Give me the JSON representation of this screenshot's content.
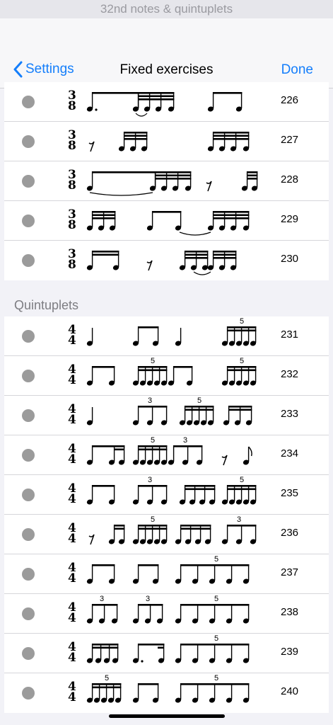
{
  "window": {
    "title": "32nd notes & quintuplets"
  },
  "nav": {
    "back_label": "Settings",
    "title": "Fixed exercises",
    "done_label": "Done"
  },
  "section": {
    "header": "Quintuplets"
  },
  "colors": {
    "accent": "#147efb",
    "dot": "#9b9b9b"
  },
  "exercises_top": [
    {
      "number": "226",
      "time_sig": [
        "3",
        "8"
      ],
      "tuplets": [],
      "pattern": "D . | 32 32 32 32 | 8 8"
    },
    {
      "number": "227",
      "time_sig": [
        "3",
        "8"
      ],
      "tuplets": [],
      "pattern": "rest | 32 32 8 | 32 32 32 32"
    },
    {
      "number": "228",
      "time_sig": [
        "3",
        "8"
      ],
      "tuplets": [],
      "pattern": "8~ | 32 32 32 32 | rest | 32 32"
    },
    {
      "number": "229",
      "time_sig": [
        "3",
        "8"
      ],
      "tuplets": [],
      "pattern": "32 32 32 | 8 8~ | 32 32 32 32"
    },
    {
      "number": "230",
      "time_sig": [
        "3",
        "8"
      ],
      "tuplets": [],
      "pattern": "16 16 | rest | 32 32 32 32"
    }
  ],
  "exercises_bottom": [
    {
      "number": "231",
      "time_sig": [
        "4",
        "4"
      ],
      "tuplets": [
        "5"
      ],
      "pattern": "q | 8 8 | q | quint"
    },
    {
      "number": "232",
      "time_sig": [
        "4",
        "4"
      ],
      "tuplets": [
        "5",
        "5"
      ],
      "pattern": "8 8 | quint | 8 8 | quint"
    },
    {
      "number": "233",
      "time_sig": [
        "4",
        "4"
      ],
      "tuplets": [
        "3",
        "5"
      ],
      "pattern": "q | trip | quint | 16x3"
    },
    {
      "number": "234",
      "time_sig": [
        "4",
        "4"
      ],
      "tuplets": [
        "5",
        "3"
      ],
      "pattern": "8 16 16 | quint | trip | rest 8"
    },
    {
      "number": "235",
      "time_sig": [
        "4",
        "4"
      ],
      "tuplets": [
        "3",
        "5"
      ],
      "pattern": "8 8 | trip | 16x4 | quint"
    },
    {
      "number": "236",
      "time_sig": [
        "4",
        "4"
      ],
      "tuplets": [
        "5",
        "3"
      ],
      "pattern": "rest 16 16 | quint | 16x4 | trip"
    },
    {
      "number": "237",
      "time_sig": [
        "4",
        "4"
      ],
      "tuplets": [
        "5"
      ],
      "pattern": "8 8 | 8 8 | quint8"
    },
    {
      "number": "238",
      "time_sig": [
        "4",
        "4"
      ],
      "tuplets": [
        "3",
        "3",
        "5"
      ],
      "pattern": "trip | trip | quint8"
    },
    {
      "number": "239",
      "time_sig": [
        "4",
        "4"
      ],
      "tuplets": [
        "5"
      ],
      "pattern": "16x4 | 8. 16 | quint8"
    },
    {
      "number": "240",
      "time_sig": [
        "4",
        "4"
      ],
      "tuplets": [
        "5",
        "5"
      ],
      "pattern": "quint | 8 8 | quint8"
    }
  ]
}
